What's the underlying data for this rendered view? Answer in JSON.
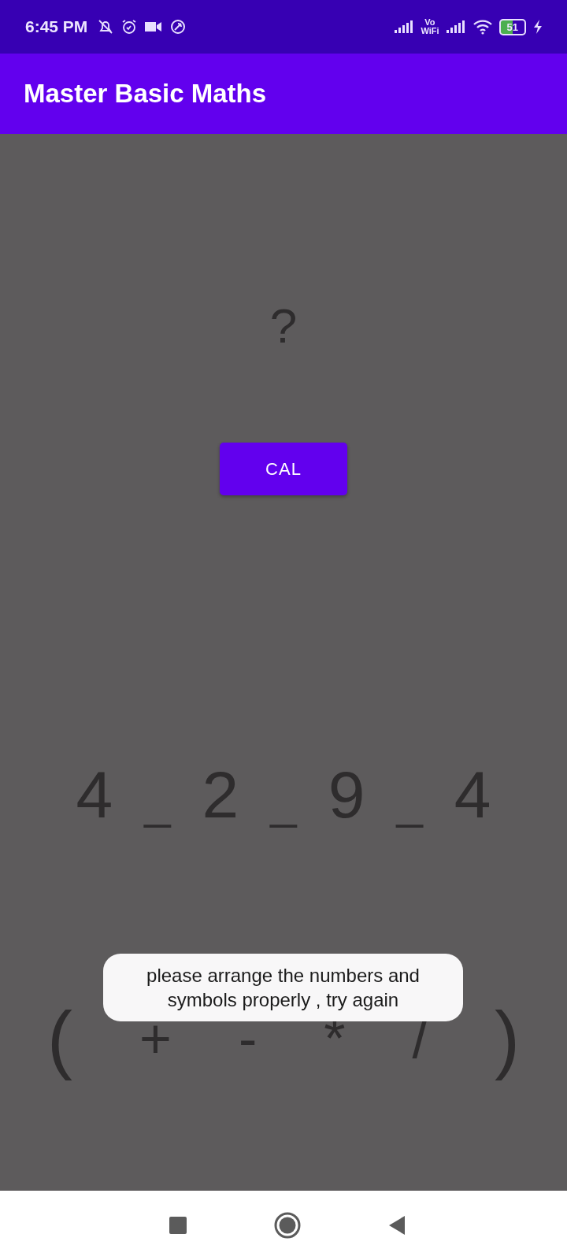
{
  "status_bar": {
    "time": "6:45 PM",
    "volte": [
      "Vo",
      "WiFi"
    ],
    "battery": "51"
  },
  "app_bar": {
    "title": "Master Basic Maths"
  },
  "result": "?",
  "calculate_button": "CAL",
  "expression": [
    "4",
    "_",
    "2",
    "_",
    "9",
    "_",
    "4"
  ],
  "operators": [
    "(",
    "+",
    "-",
    "*",
    "/",
    ")"
  ],
  "toast": "please arrange the numbers and symbols properly , try again"
}
